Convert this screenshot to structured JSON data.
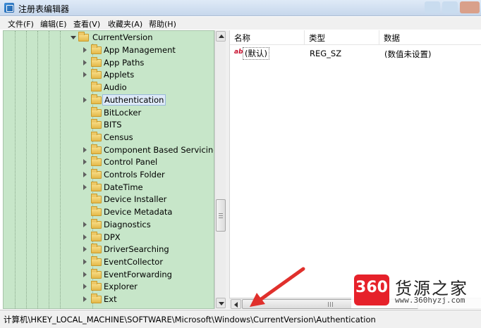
{
  "window": {
    "title": "注册表编辑器"
  },
  "menu": [
    "文件(F)",
    "编辑(E)",
    "查看(V)",
    "收藏夹(A)",
    "帮助(H)"
  ],
  "tree": {
    "root_label": "CurrentVersion",
    "items": [
      {
        "label": "App Management",
        "expandable": true
      },
      {
        "label": "App Paths",
        "expandable": true
      },
      {
        "label": "Applets",
        "expandable": true
      },
      {
        "label": "Audio",
        "expandable": false
      },
      {
        "label": "Authentication",
        "expandable": true,
        "selected": true
      },
      {
        "label": "BitLocker",
        "expandable": false
      },
      {
        "label": "BITS",
        "expandable": false
      },
      {
        "label": "Census",
        "expandable": false
      },
      {
        "label": "Component Based Servicing",
        "expandable": true
      },
      {
        "label": "Control Panel",
        "expandable": true
      },
      {
        "label": "Controls Folder",
        "expandable": true
      },
      {
        "label": "DateTime",
        "expandable": true
      },
      {
        "label": "Device Installer",
        "expandable": false
      },
      {
        "label": "Device Metadata",
        "expandable": false
      },
      {
        "label": "Diagnostics",
        "expandable": true
      },
      {
        "label": "DPX",
        "expandable": true
      },
      {
        "label": "DriverSearching",
        "expandable": true
      },
      {
        "label": "EventCollector",
        "expandable": true
      },
      {
        "label": "EventForwarding",
        "expandable": true
      },
      {
        "label": "Explorer",
        "expandable": true
      },
      {
        "label": "Ext",
        "expandable": true
      }
    ]
  },
  "list": {
    "columns": [
      "名称",
      "类型",
      "数据"
    ],
    "rows": [
      {
        "icon": "ab",
        "name": "(默认)",
        "type": "REG_SZ",
        "data": "(数值未设置)"
      }
    ]
  },
  "status": {
    "path": "计算机\\HKEY_LOCAL_MACHINE\\SOFTWARE\\Microsoft\\Windows\\CurrentVersion\\Authentication"
  },
  "watermark": {
    "logo": "360",
    "title": "货源之家",
    "url": "www.360hyzj.com"
  },
  "colors": {
    "tree_background": "#c7e6c9",
    "annotation_arrow": "#e0302c",
    "watermark_red": "#e6212a"
  }
}
